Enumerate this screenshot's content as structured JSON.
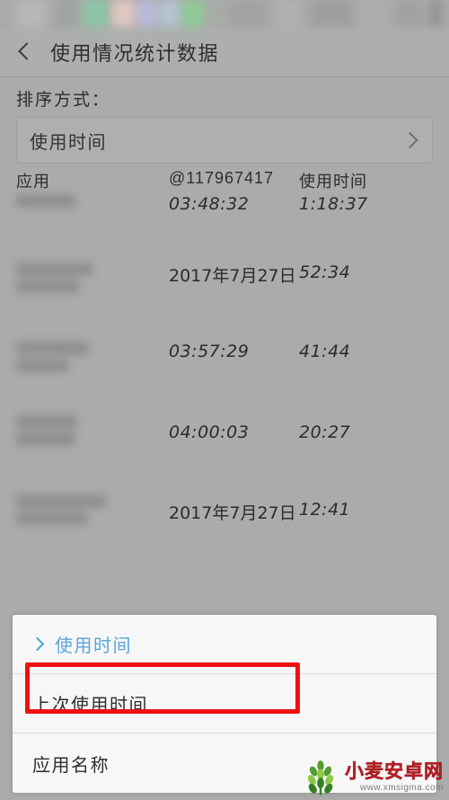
{
  "app": {
    "title": "使用情况统计数据",
    "back_icon": "chevron-left-icon"
  },
  "sort": {
    "label": "排序方式：",
    "value": "使用时间",
    "chevron_icon": "chevron-right-icon"
  },
  "table": {
    "headers": {
      "app": "应用",
      "last_used": "@117967417",
      "usage_time": "使用时间"
    },
    "rows": [
      {
        "app": "",
        "last_used": "03:48:32",
        "usage_time": "1:18:37"
      },
      {
        "app": "",
        "last_used": "2017年7月27日",
        "usage_time": "52:34"
      },
      {
        "app": "",
        "last_used": "03:57:29",
        "usage_time": "41:44"
      },
      {
        "app": "",
        "last_used": "04:00:03",
        "usage_time": "20:27"
      },
      {
        "app": "",
        "last_used": "2017年7月27日",
        "usage_time": "12:41"
      }
    ]
  },
  "sheet": {
    "options": [
      {
        "label": "使用时间",
        "selected": true,
        "chevron_icon": "chevron-right-icon"
      },
      {
        "label": "上次使用时间",
        "selected": false,
        "highlighted": true
      },
      {
        "label": "应用名称",
        "selected": false
      }
    ]
  },
  "annotation": {
    "highlight_color": "#ee1111"
  },
  "watermark": {
    "name": "小麦安卓网",
    "url": "www.xmsigma.com"
  },
  "colors": {
    "background": "#ababab",
    "titlebar": "#adafad",
    "sheet": "#f4f4f4",
    "accent_blue": "#5aa6d8",
    "annotation_red": "#ee1111"
  }
}
